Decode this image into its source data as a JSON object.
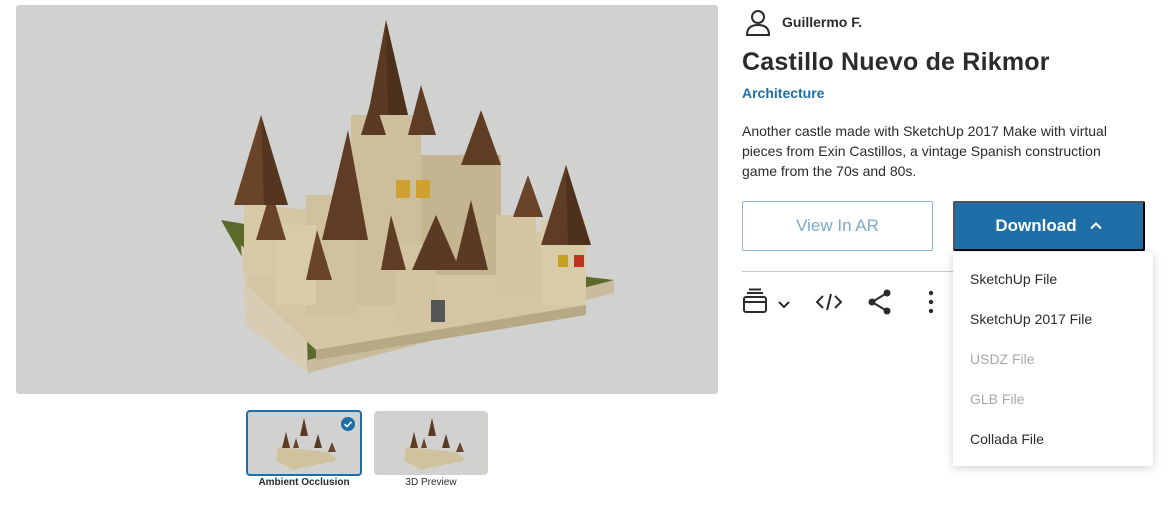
{
  "author": {
    "name": "Guillermo F.",
    "icon": "user-avatar-icon"
  },
  "model": {
    "title": "Castillo Nuevo de Rikmor",
    "category": "Architecture",
    "description": "Another castle made with SketchUp 2017 Make with virtual pieces from Exin Castillos, a vintage Spanish construction game from the 70s and 80s."
  },
  "thumbnails": [
    {
      "label": "Ambient Occlusion",
      "selected": true
    },
    {
      "label": "3D Preview",
      "selected": false
    }
  ],
  "buttons": {
    "view_ar": "View In AR",
    "download": "Download"
  },
  "toolbar": {
    "icons": [
      "collections-icon",
      "chevron-down-icon",
      "embed-code-icon",
      "share-icon",
      "more-vertical-icon"
    ]
  },
  "download_menu": {
    "items": [
      {
        "label": "SketchUp File",
        "enabled": true
      },
      {
        "label": "SketchUp 2017 File",
        "enabled": true
      },
      {
        "label": "USDZ File",
        "enabled": false
      },
      {
        "label": "GLB File",
        "enabled": false
      },
      {
        "label": "Collada File",
        "enabled": true
      }
    ]
  },
  "colors": {
    "accent": "#1e6ea8",
    "viewer_bg": "#d1d1cf",
    "disabled_text": "#a8a8a8"
  }
}
